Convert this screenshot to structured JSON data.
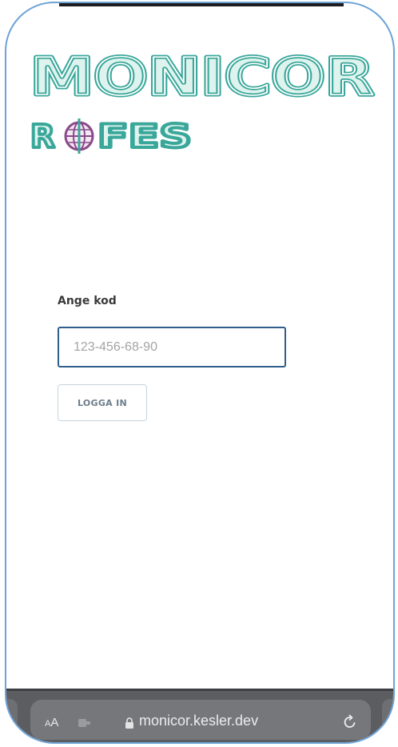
{
  "logo": {
    "primary_text": "MONICOR",
    "secondary_text": "R⊕FES",
    "colors": {
      "teal_outline": "#3aa79a",
      "teal_fill": "#e6f5f1",
      "purple_ring": "#8a4a8c"
    }
  },
  "login": {
    "label": "Ange kod",
    "input_value": "",
    "input_placeholder": "123-456-68-90",
    "button_label": "LOGGA IN"
  },
  "browser": {
    "text_size_label_small": "A",
    "text_size_label_large": "A",
    "url": "monicor.kesler.dev",
    "icons": [
      "puzzle-extension-icon",
      "lock-icon",
      "reload-icon"
    ]
  },
  "colors": {
    "input_border": "#2f5f8a",
    "frame_border": "#6ea3d6",
    "chrome_bg": "#5c5d61"
  }
}
